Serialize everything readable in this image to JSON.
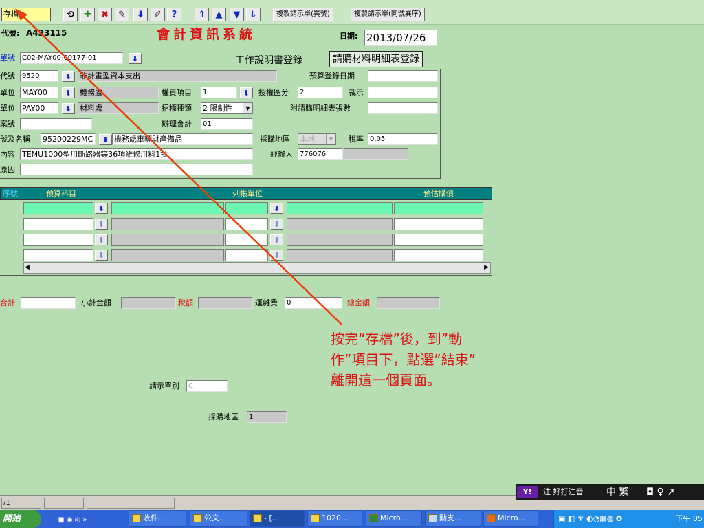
{
  "toolbar": {
    "save_label": "存檔",
    "copy_diff_label": "複製請示單(異號)",
    "copy_same_label": "複製請示單(同號異序)"
  },
  "header": {
    "code_label": "代號:",
    "code_value": "A433115",
    "title": "會計資訊系統",
    "date_label": "日期:",
    "date_value": "2013/07/26"
  },
  "form_top": {
    "bill_label": "單號",
    "bill_value": "C02-MAY00-00177-01",
    "btn_work": "工作說明書登錄",
    "btn_material": "請購材料明細表登錄"
  },
  "fields": {
    "budget_code_label": "代號",
    "budget_code": "9520",
    "budget_code_name": "非計畫型資本支出",
    "budget_date_label": "預算登錄日期",
    "unit_label": "單位",
    "unit_code": "MAY00",
    "unit_name": "機務處",
    "resp_item_label": "權責項目",
    "resp_item": "1",
    "auth_class_label": "授權區分",
    "auth_class": "2",
    "approve_label": "裁示",
    "pay_unit_label": "單位",
    "pay_unit_code": "PAY00",
    "pay_unit_name": "材料處",
    "bid_type_label": "招標種類",
    "bid_type": "2 限制性",
    "attach_label": "附請購明細表張數",
    "case_label": "案號",
    "acct_label": "辦理會計",
    "acct_value": "01",
    "code_name_label": "號及名稱",
    "asset_code": "95200229MC",
    "asset_name": "機務處車輛財產備品",
    "region_label": "採購地區",
    "region_value": "本地",
    "tax_label": "稅率",
    "tax_value": "0.05",
    "content_label": "內容",
    "content_value": "TEMU1000型用斷路器等36項維修用料1批",
    "handler_label": "經辦人",
    "handler_value": "776076",
    "reason_label": "原因"
  },
  "grid": {
    "col_seq": "序號",
    "col_budget": "預算科目",
    "col_unit": "列帳單位",
    "col_price": "預估購價"
  },
  "totals": {
    "subtotal_label": "合計",
    "sub_amount_label": "小計金額",
    "tax_amount_label": "稅額",
    "freight_label": "運雜費",
    "freight_value": "0",
    "total_label": "總金額"
  },
  "lower": {
    "approval_type_label": "請示單別",
    "approval_type_value": "C",
    "region2_label": "採購地區",
    "region2_value": "1"
  },
  "annotation": {
    "line1": "按完“存檔”後，到”動",
    "line2": "作”項目下，點選”結束”",
    "line3": "離開這一個頁面。"
  },
  "status": {
    "page": "/1"
  },
  "ime": {
    "brand": "Y!",
    "label": "注 好打注音",
    "mode": "中 繁"
  },
  "taskbar": {
    "start": "開始",
    "buttons": [
      "收件...",
      "公文...",
      "- [...",
      "1020...",
      "Micro...",
      "動支...",
      "Micro..."
    ],
    "clock": "下午 05"
  },
  "colors": {
    "bg": "#b7ddb2",
    "grid_header": "#008080",
    "select_row": "#6cf6b4",
    "title_red": "#e01010",
    "annotation_arrow": "#e8400a"
  }
}
